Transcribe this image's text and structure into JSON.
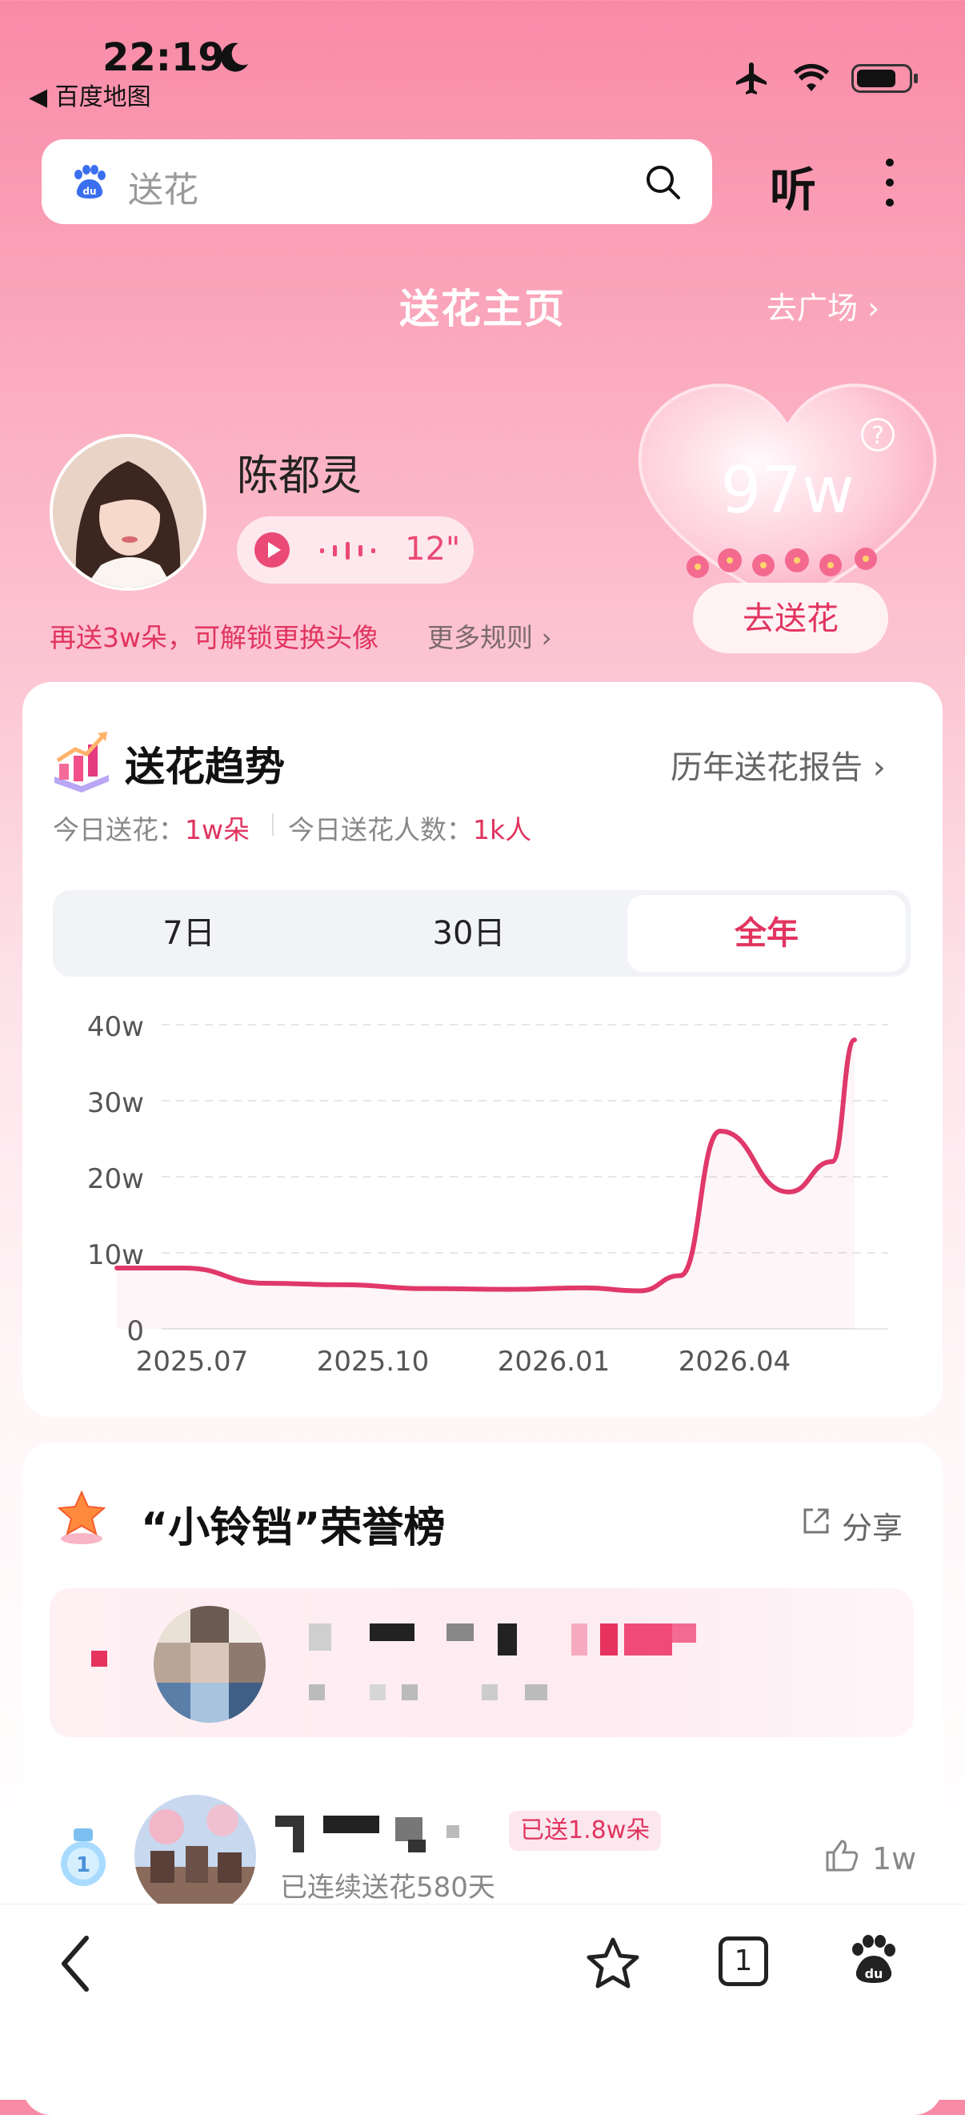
{
  "status_bar": {
    "time": "22:19",
    "back_app": "◀ 百度地图"
  },
  "search": {
    "placeholder": "送花",
    "listen_label": "听"
  },
  "header": {
    "title": "送花主页",
    "plaza_link": "去广场 ›"
  },
  "profile": {
    "name": "陈都灵",
    "voice_duration": "12\"",
    "unlock_tip": "再送3w朵，可解锁更换头像",
    "more_rules": "更多规则 ›"
  },
  "heart": {
    "count": "97w",
    "help": "?",
    "send_button": "去送花"
  },
  "trend": {
    "title": "送花趋势",
    "report_link": "历年送花报告 ›",
    "today_label": "今日送花：",
    "today_value": "1w朵",
    "people_label": "今日送花人数：",
    "people_value": "1k人",
    "tabs": [
      {
        "label": "7日"
      },
      {
        "label": "30日"
      },
      {
        "label": "全年"
      }
    ],
    "active_tab": 2
  },
  "chart_data": {
    "type": "line",
    "title": "",
    "xlabel": "",
    "ylabel": "",
    "ylim": [
      0,
      40
    ],
    "yticks": [
      "0",
      "10w",
      "20w",
      "30w",
      "40w"
    ],
    "xticks": [
      "2025.07",
      "2025.10",
      "2026.01",
      "2026.04"
    ],
    "x": [
      "2025.07",
      "2025.08",
      "2025.09",
      "2025.10",
      "2025.11",
      "2025.12",
      "2026.01",
      "2026.02",
      "2026.03",
      "2026.03",
      "2026.04",
      "2026.05",
      "2026.06"
    ],
    "series": [
      {
        "values": [
          8,
          8,
          6,
          5.8,
          5.3,
          5.2,
          5.4,
          5.0,
          7.0,
          26,
          18,
          22,
          38
        ]
      }
    ],
    "color": "#e0386a",
    "grid": true
  },
  "honor": {
    "title": "“小铃铛”荣誉榜",
    "share": "分享",
    "row2": {
      "rank": "1",
      "sent_badge": "已送1.8w朵",
      "streak": "已连续送花580天",
      "likes": "1w"
    }
  },
  "bottom_nav": {
    "tab_count": "1"
  }
}
